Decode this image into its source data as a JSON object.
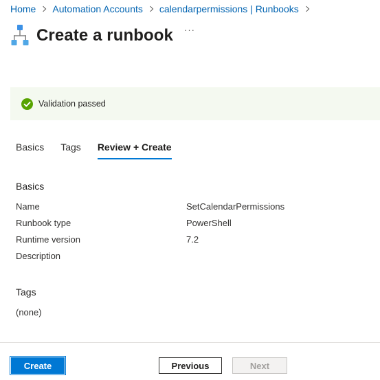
{
  "breadcrumb": {
    "items": [
      {
        "label": "Home"
      },
      {
        "label": "Automation Accounts"
      },
      {
        "label": "calendarpermissions | Runbooks"
      }
    ]
  },
  "header": {
    "title": "Create a runbook",
    "icon": "runbook-hierarchy-icon",
    "more_label": "···"
  },
  "validation": {
    "status_text": "Validation passed",
    "icon": "check-circle-icon",
    "color": "#57a300"
  },
  "tabs": [
    {
      "label": "Basics",
      "active": false
    },
    {
      "label": "Tags",
      "active": false
    },
    {
      "label": "Review + Create",
      "active": true
    }
  ],
  "review": {
    "basics_heading": "Basics",
    "fields": [
      {
        "label": "Name",
        "value": "SetCalendarPermissions"
      },
      {
        "label": "Runbook type",
        "value": "PowerShell"
      },
      {
        "label": "Runtime version",
        "value": "7.2"
      },
      {
        "label": "Description",
        "value": ""
      }
    ],
    "tags_heading": "Tags",
    "tags_value": "(none)"
  },
  "footer": {
    "create_label": "Create",
    "previous_label": "Previous",
    "next_label": "Next"
  },
  "colors": {
    "accent": "#0078d4",
    "link": "#0063b1",
    "success": "#57a300",
    "validation_bg": "#f4f9f0"
  }
}
